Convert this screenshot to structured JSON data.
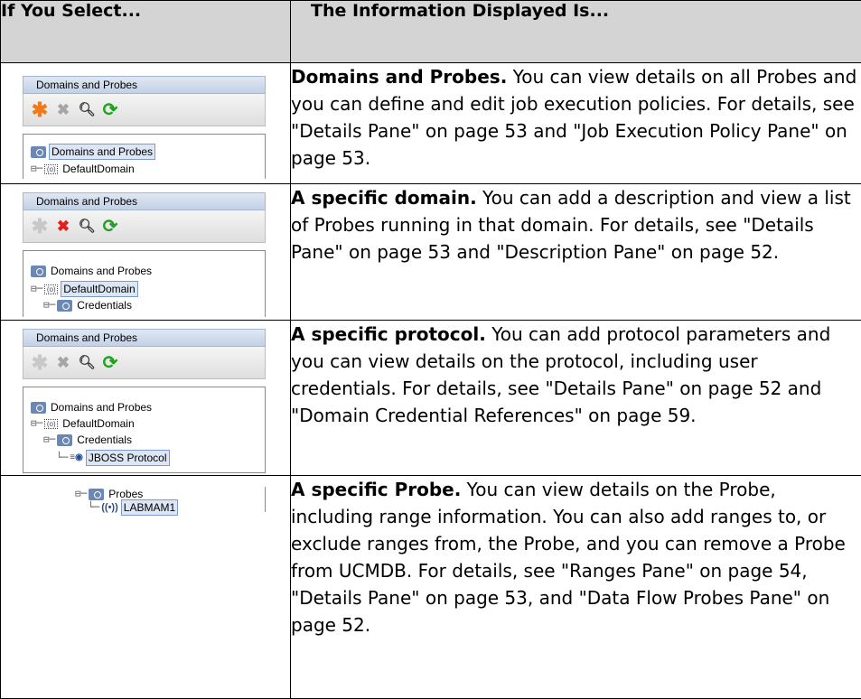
{
  "table": {
    "headers": [
      "If You Select...",
      "The Information Displayed Is..."
    ],
    "rows": [
      {
        "panel": {
          "title": "Domains and Probes",
          "toolbar": [
            "new-star-icon",
            "delete-x-icon",
            "search-icon",
            "refresh-icon"
          ],
          "tree": [
            "Domains and Probes",
            "DefaultDomain"
          ],
          "selected": "Domains and Probes"
        },
        "lead": "Domains and Probes.",
        "text": " You can view details on all Probes and you can define and edit job execution policies. For details, see \"Details Pane\" on page 53 and \"Job Execution Policy Pane\" on page 53."
      },
      {
        "panel": {
          "title": "Domains and Probes",
          "toolbar": [
            "new-star-icon",
            "delete-x-icon",
            "search-icon",
            "refresh-icon"
          ],
          "tree": [
            "Domains and Probes",
            "DefaultDomain",
            "Credentials"
          ],
          "selected": "DefaultDomain"
        },
        "lead": "A specific domain.",
        "text": " You can add a description and view a list of Probes running in that domain. For details, see \"Details Pane\" on page 53 and \"Description Pane\" on page 52."
      },
      {
        "panel": {
          "title": "Domains and Probes",
          "toolbar": [
            "new-star-icon",
            "delete-x-icon",
            "search-icon",
            "refresh-icon"
          ],
          "tree": [
            "Domains and Probes",
            "DefaultDomain",
            "Credentials",
            "JBOSS Protocol"
          ],
          "selected": "JBOSS Protocol"
        },
        "lead": "A specific protocol.",
        "text": " You can add protocol parameters and you can view details on the protocol, including user credentials. For details, see \"Details Pane\" on page 52 and \"Domain Credential References\" on page 59."
      },
      {
        "panel": {
          "tree": [
            "Probes",
            "LABMAM1"
          ],
          "selected": "LABMAM1"
        },
        "lead": "A specific Probe.",
        "text": " You can view details on the Probe, including range information. You can also add ranges to, or exclude ranges from, the Probe, and you can remove a Probe from UCMDB. For details, see \"Ranges Pane\" on page 54, \"Details Pane\" on page 53, and \"Data Flow Probes Pane\" on page 52."
      }
    ]
  }
}
